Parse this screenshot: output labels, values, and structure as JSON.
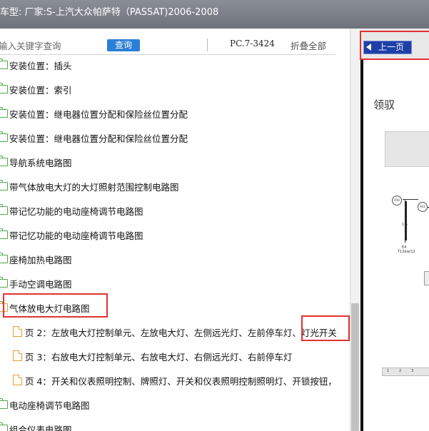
{
  "window": {
    "title": "车型:  厂家:S-上汽大众帕萨特（PASSAT)2006-2008"
  },
  "toolbar": {
    "search_placeholder": "输入关键字查询",
    "query_label": "查询",
    "page_code": "PC.7-3424",
    "collapse_all_label": "折叠全部"
  },
  "tree": {
    "rows": [
      {
        "type": "folder",
        "label": "安装位置：插头"
      },
      {
        "type": "folder",
        "label": "安装位置：索引"
      },
      {
        "type": "folder",
        "label": "安装位置：继电器位置分配和保险丝位置分配"
      },
      {
        "type": "folder",
        "label": "安装位置：继电器位置分配和保险丝位置分配"
      },
      {
        "type": "folder",
        "label": "导航系统电路图"
      },
      {
        "type": "folder",
        "label": "带气体放电大灯的大灯照射范围控制电路图"
      },
      {
        "type": "folder",
        "label": "带记忆功能的电动座椅调节电路图"
      },
      {
        "type": "folder",
        "label": "带记忆功能的电动座椅调节电路图"
      },
      {
        "type": "folder",
        "label": "座椅加热电路图"
      },
      {
        "type": "folder",
        "label": "手动空调电路图"
      },
      {
        "type": "folder-open",
        "label": "气体放电大灯电路图"
      },
      {
        "type": "page",
        "label": "页 2：左放电大灯控制单元、左放电大灯、左侧远光灯、左前停车灯、灯光开关"
      },
      {
        "type": "page",
        "label": "页 3：右放电大灯控制单元、右放电大灯、右侧远光灯、右前停车灯"
      },
      {
        "type": "page",
        "label": "页 4：开关和仪表照明控制、牌照灯、开关和仪表照明控制照明灯、开锁按钮，"
      },
      {
        "type": "folder",
        "label": "电动座椅调节电路图"
      },
      {
        "type": "folder",
        "label": "组合仪表电路图"
      }
    ]
  },
  "viewer": {
    "prev_page_label": "上一页",
    "doc_title": "领驭",
    "node_labels": [
      "A50",
      "A51"
    ],
    "wire_label": "1.5",
    "component_label": "E4",
    "component_sub": "T12bw/12",
    "ruler_ticks": [
      "1",
      "2",
      "3"
    ]
  },
  "colors": {
    "accent": "#2b7fd6",
    "highlight": "#e23232",
    "folder": "#53a84a",
    "page": "#e0a030"
  }
}
